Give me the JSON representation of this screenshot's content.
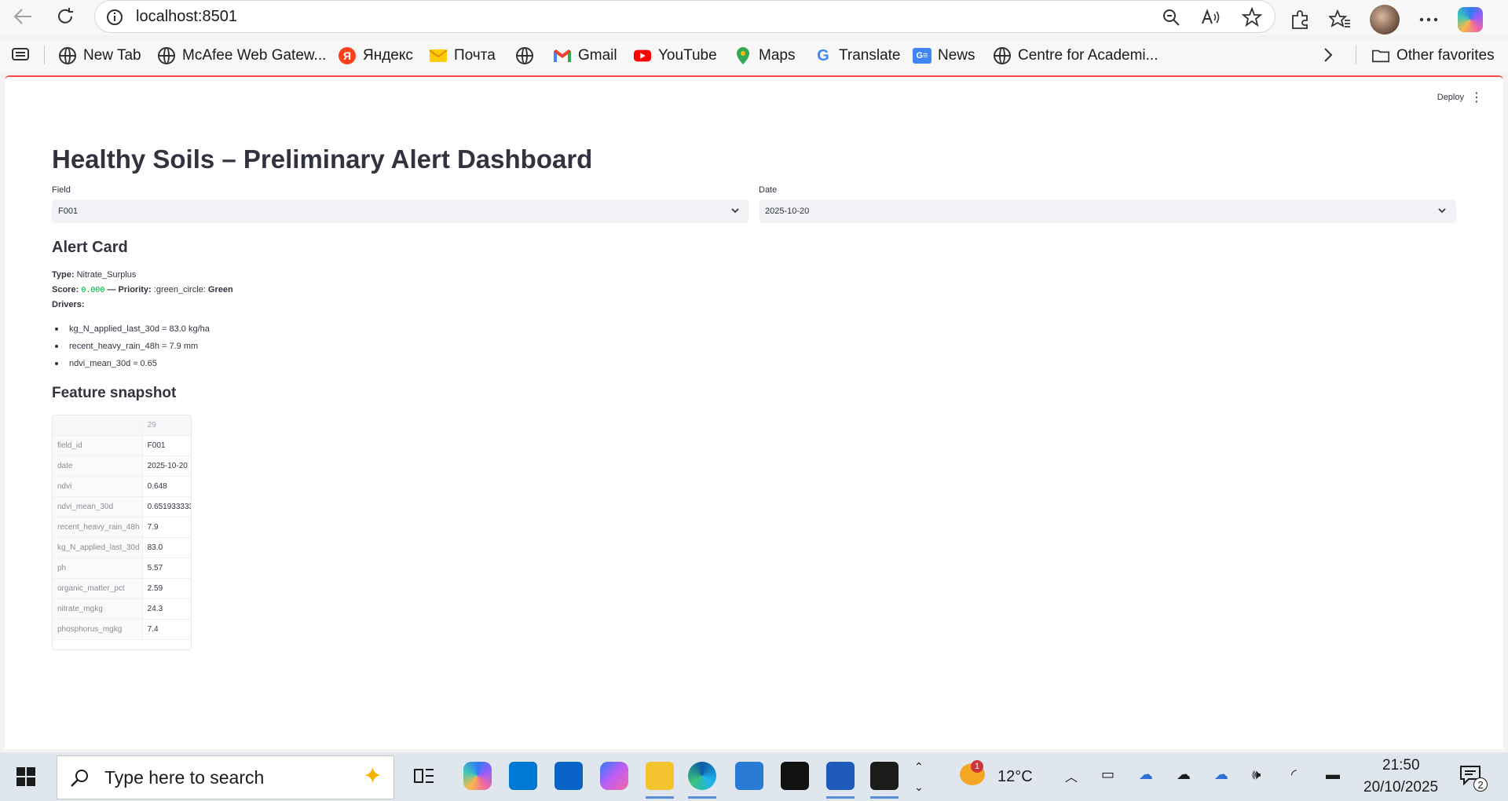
{
  "browser": {
    "url": "localhost:8501",
    "favorites": [
      {
        "label": "New Tab",
        "icon": "globe-icon"
      },
      {
        "label": "McAfee Web Gatew...",
        "icon": "globe-icon"
      },
      {
        "label": "Яндекс",
        "icon": "yandex-icon"
      },
      {
        "label": "Почта",
        "icon": "mail-icon"
      },
      {
        "label": "",
        "icon": "globe-icon"
      },
      {
        "label": "Gmail",
        "icon": "gmail-icon"
      },
      {
        "label": "YouTube",
        "icon": "youtube-icon"
      },
      {
        "label": "Maps",
        "icon": "maps-icon"
      },
      {
        "label": "Translate",
        "icon": "google-icon"
      },
      {
        "label": "News",
        "icon": "news-icon"
      },
      {
        "label": "Centre for Academi...",
        "icon": "globe-icon"
      }
    ],
    "other_favorites": "Other favorites"
  },
  "app": {
    "deploy_label": "Deploy",
    "title": "Healthy Soils – Preliminary Alert Dashboard",
    "field_label": "Field",
    "field_value": "F001",
    "date_label": "Date",
    "date_value": "2025-10-20",
    "alert_heading": "Alert Card",
    "type_label": "Type:",
    "type_value": "Nitrate_Surplus",
    "score_label": "Score:",
    "score_value": "0.000",
    "priority_sep": "— Priority:",
    "priority_emoji": ":green_circle:",
    "priority_value": "Green",
    "drivers_label": "Drivers:",
    "drivers": [
      "kg_N_applied_last_30d = 83.0 kg/ha",
      "recent_heavy_rain_48h = 7.9 mm",
      "ndvi_mean_30d ≈ 0.65"
    ],
    "snapshot_heading": "Feature snapshot",
    "table_header": "29",
    "table_rows": [
      {
        "k": "field_id",
        "v": "F001"
      },
      {
        "k": "date",
        "v": "2025-10-20"
      },
      {
        "k": "ndvi",
        "v": "0.648"
      },
      {
        "k": "ndvi_mean_30d",
        "v": "0.651933333"
      },
      {
        "k": "recent_heavy_rain_48h",
        "v": "7.9"
      },
      {
        "k": "kg_N_applied_last_30d",
        "v": "83.0"
      },
      {
        "k": "ph",
        "v": "5.57"
      },
      {
        "k": "organic_matter_pct",
        "v": "2.59"
      },
      {
        "k": "nitrate_mgkg",
        "v": "24.3"
      },
      {
        "k": "phosphorus_mgkg",
        "v": "7.4"
      }
    ]
  },
  "taskbar": {
    "search_placeholder": "Type here to search",
    "weather_temp": "12°C",
    "weather_badge": "1",
    "time": "21:50",
    "date": "20/10/2025",
    "notifications": "2"
  },
  "colors": {
    "accent": "#ff4b4b",
    "code_green": "#09ab3b",
    "select_bg": "#f0f2f6"
  }
}
